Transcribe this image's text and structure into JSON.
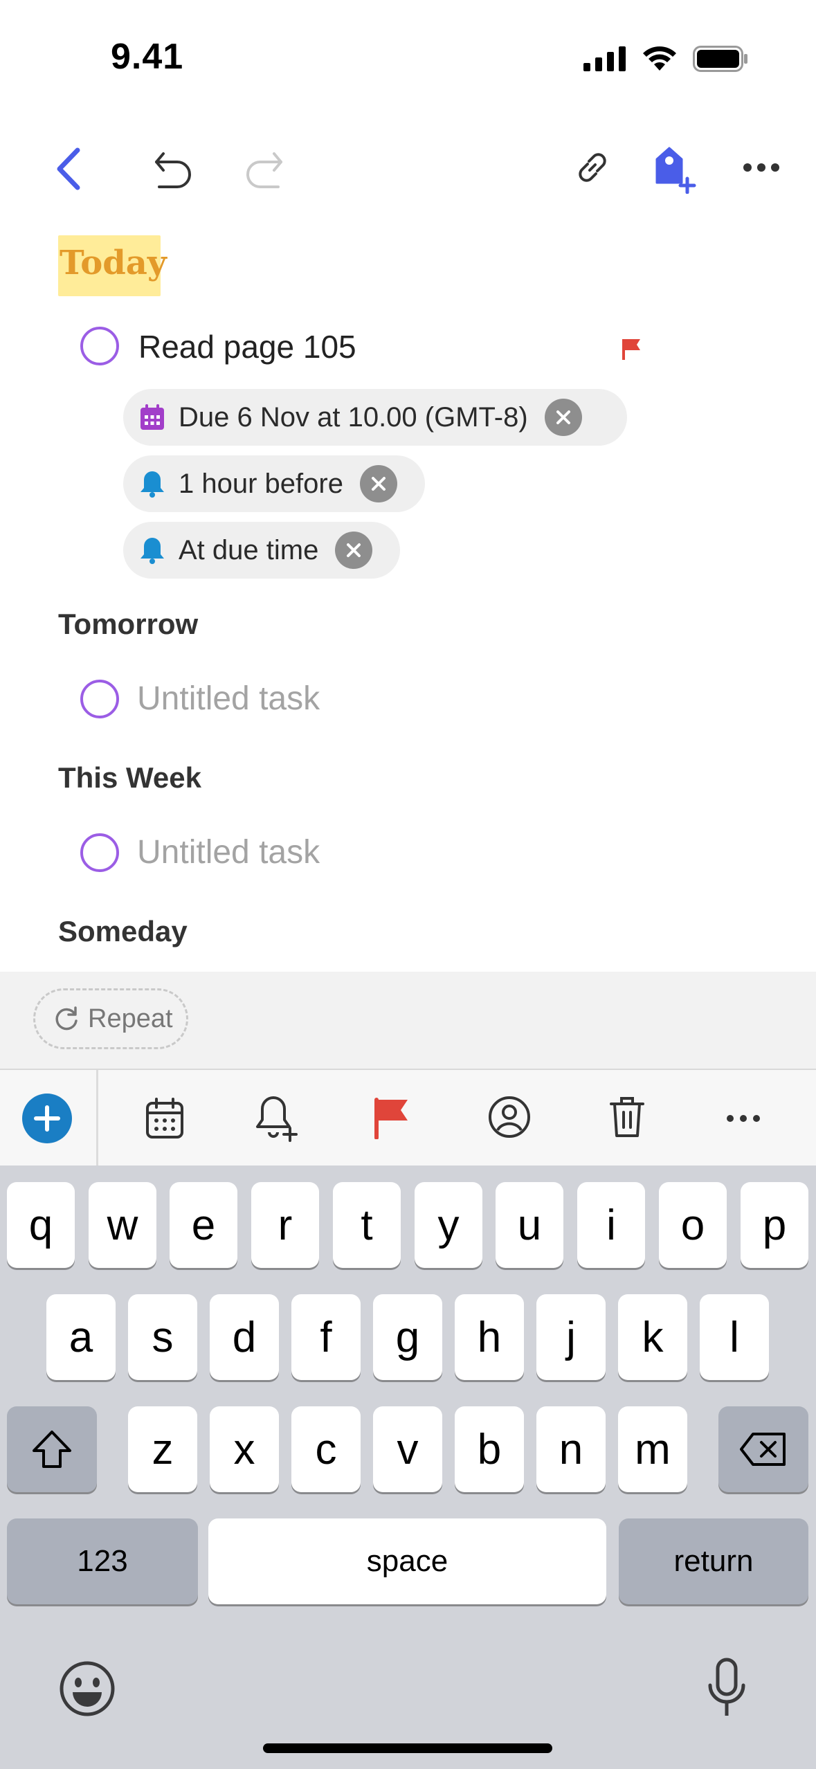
{
  "status": {
    "time": "9.41"
  },
  "toolbar": {
    "back": "back-icon",
    "undo": "undo-icon",
    "redo": "redo-icon",
    "link": "link-icon",
    "tag": "tag-add-icon",
    "more": "more-icon",
    "accent": "#4a5de8"
  },
  "sections": {
    "today": "Today",
    "tomorrow": "Tomorrow",
    "this_week": "This Week",
    "someday": "Someday"
  },
  "task1": {
    "title": "Read page 105",
    "flag_color": "#e0453a",
    "chips": {
      "due": "Due 6 Nov at 10.00 (GMT-8)",
      "reminder1": "1 hour before",
      "reminder2": "At due time"
    }
  },
  "task2": {
    "placeholder": "Untitled task"
  },
  "task3": {
    "placeholder": "Untitled task"
  },
  "repeat": {
    "label": "Repeat"
  },
  "format_bar": {
    "icons": [
      "add-icon",
      "calendar-icon",
      "bell-add-icon",
      "flag-icon",
      "person-icon",
      "trash-icon",
      "more-icon"
    ],
    "add_color": "#1a7ec4",
    "flag_color": "#e0453a"
  },
  "keyboard": {
    "row1": [
      "q",
      "w",
      "e",
      "r",
      "t",
      "y",
      "u",
      "i",
      "o",
      "p"
    ],
    "row2": [
      "a",
      "s",
      "d",
      "f",
      "g",
      "h",
      "j",
      "k",
      "l"
    ],
    "row3": [
      "z",
      "x",
      "c",
      "v",
      "b",
      "n",
      "m"
    ],
    "numbers": "123",
    "space": "space",
    "return": "return"
  }
}
